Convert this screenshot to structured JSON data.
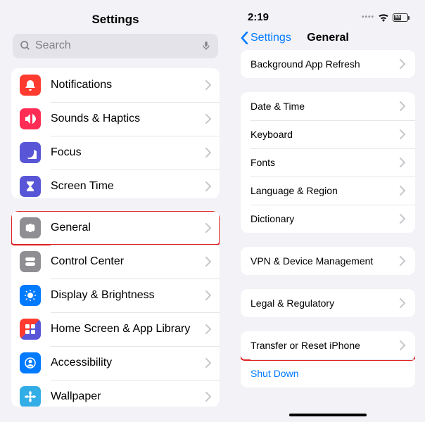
{
  "left": {
    "title": "Settings",
    "search_placeholder": "Search",
    "group1": [
      {
        "label": "Notifications",
        "icon": "bell",
        "bg": "bg-red"
      },
      {
        "label": "Sounds & Haptics",
        "icon": "speaker",
        "bg": "bg-pink"
      },
      {
        "label": "Focus",
        "icon": "moon",
        "bg": "bg-indigo"
      },
      {
        "label": "Screen Time",
        "icon": "hourglass",
        "bg": "bg-indigo"
      }
    ],
    "group2": [
      {
        "label": "General",
        "icon": "gear",
        "bg": "bg-gray",
        "highlight": true
      },
      {
        "label": "Control Center",
        "icon": "toggles",
        "bg": "bg-gray"
      },
      {
        "label": "Display & Brightness",
        "icon": "sun",
        "bg": "bg-blue"
      },
      {
        "label": "Home Screen & App Library",
        "icon": "grid",
        "bg": "bg-multi"
      },
      {
        "label": "Accessibility",
        "icon": "person",
        "bg": "bg-blue"
      },
      {
        "label": "Wallpaper",
        "icon": "flower",
        "bg": "bg-cyan"
      }
    ]
  },
  "right": {
    "time": "2:19",
    "battery": "55",
    "back_label": "Settings",
    "title": "General",
    "group0": [
      {
        "label": "Background App Refresh"
      }
    ],
    "group1": [
      {
        "label": "Date & Time"
      },
      {
        "label": "Keyboard"
      },
      {
        "label": "Fonts"
      },
      {
        "label": "Language & Region"
      },
      {
        "label": "Dictionary"
      }
    ],
    "group2": [
      {
        "label": "VPN & Device Management"
      }
    ],
    "group3": [
      {
        "label": "Legal & Regulatory"
      }
    ],
    "group4": [
      {
        "label": "Transfer or Reset iPhone",
        "highlight": true
      },
      {
        "label": "Shut Down",
        "link": true,
        "no_chevron": true
      }
    ]
  }
}
